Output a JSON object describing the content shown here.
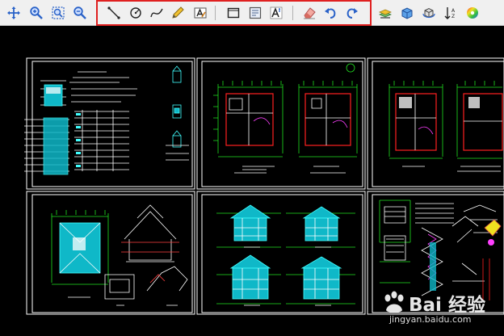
{
  "app": {
    "accent_color": "#e02020"
  },
  "toolbar": {
    "buttons": [
      {
        "icon": "pan-icon"
      },
      {
        "icon": "zoom-in-icon"
      },
      {
        "icon": "zoom-window-icon"
      },
      {
        "icon": "zoom-previous-icon"
      },
      {
        "icon": "line-icon"
      },
      {
        "icon": "circle-icon"
      },
      {
        "icon": "spline-icon"
      },
      {
        "icon": "pencil-icon"
      },
      {
        "icon": "markup-text-icon"
      },
      {
        "icon": "rectangle-icon"
      },
      {
        "icon": "block-icon"
      },
      {
        "icon": "text-style-icon"
      },
      {
        "icon": "eraser-icon"
      },
      {
        "icon": "undo-icon"
      },
      {
        "icon": "redo-icon"
      },
      {
        "icon": "layers-icon"
      },
      {
        "icon": "3d-view-icon"
      },
      {
        "icon": "3d-orbit-icon"
      },
      {
        "icon": "sort-icon"
      },
      {
        "icon": "color-wheel-icon"
      }
    ]
  },
  "drawing": {
    "sheets": [
      {
        "name": "design-notes-sheet"
      },
      {
        "name": "floor-plan-sheet-1"
      },
      {
        "name": "floor-plan-sheet-2"
      },
      {
        "name": "roof-plan-sheet"
      },
      {
        "name": "elevation-sheet"
      },
      {
        "name": "detail-sheet"
      }
    ]
  },
  "watermark": {
    "brand": "Bai 经验",
    "url": "jingyan.baidu.com"
  }
}
